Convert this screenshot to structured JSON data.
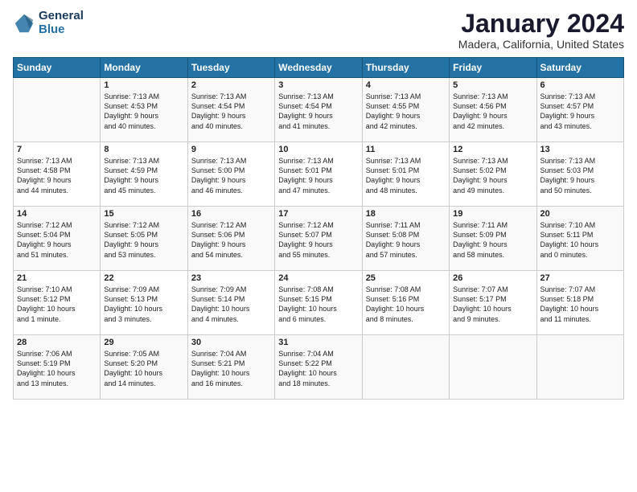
{
  "logo": {
    "line1": "General",
    "line2": "Blue"
  },
  "title": "January 2024",
  "location": "Madera, California, United States",
  "days_header": [
    "Sunday",
    "Monday",
    "Tuesday",
    "Wednesday",
    "Thursday",
    "Friday",
    "Saturday"
  ],
  "weeks": [
    [
      {
        "day": "",
        "data": ""
      },
      {
        "day": "1",
        "data": "Sunrise: 7:13 AM\nSunset: 4:53 PM\nDaylight: 9 hours\nand 40 minutes."
      },
      {
        "day": "2",
        "data": "Sunrise: 7:13 AM\nSunset: 4:54 PM\nDaylight: 9 hours\nand 40 minutes."
      },
      {
        "day": "3",
        "data": "Sunrise: 7:13 AM\nSunset: 4:54 PM\nDaylight: 9 hours\nand 41 minutes."
      },
      {
        "day": "4",
        "data": "Sunrise: 7:13 AM\nSunset: 4:55 PM\nDaylight: 9 hours\nand 42 minutes."
      },
      {
        "day": "5",
        "data": "Sunrise: 7:13 AM\nSunset: 4:56 PM\nDaylight: 9 hours\nand 42 minutes."
      },
      {
        "day": "6",
        "data": "Sunrise: 7:13 AM\nSunset: 4:57 PM\nDaylight: 9 hours\nand 43 minutes."
      }
    ],
    [
      {
        "day": "7",
        "data": "Sunrise: 7:13 AM\nSunset: 4:58 PM\nDaylight: 9 hours\nand 44 minutes."
      },
      {
        "day": "8",
        "data": "Sunrise: 7:13 AM\nSunset: 4:59 PM\nDaylight: 9 hours\nand 45 minutes."
      },
      {
        "day": "9",
        "data": "Sunrise: 7:13 AM\nSunset: 5:00 PM\nDaylight: 9 hours\nand 46 minutes."
      },
      {
        "day": "10",
        "data": "Sunrise: 7:13 AM\nSunset: 5:01 PM\nDaylight: 9 hours\nand 47 minutes."
      },
      {
        "day": "11",
        "data": "Sunrise: 7:13 AM\nSunset: 5:01 PM\nDaylight: 9 hours\nand 48 minutes."
      },
      {
        "day": "12",
        "data": "Sunrise: 7:13 AM\nSunset: 5:02 PM\nDaylight: 9 hours\nand 49 minutes."
      },
      {
        "day": "13",
        "data": "Sunrise: 7:13 AM\nSunset: 5:03 PM\nDaylight: 9 hours\nand 50 minutes."
      }
    ],
    [
      {
        "day": "14",
        "data": "Sunrise: 7:12 AM\nSunset: 5:04 PM\nDaylight: 9 hours\nand 51 minutes."
      },
      {
        "day": "15",
        "data": "Sunrise: 7:12 AM\nSunset: 5:05 PM\nDaylight: 9 hours\nand 53 minutes."
      },
      {
        "day": "16",
        "data": "Sunrise: 7:12 AM\nSunset: 5:06 PM\nDaylight: 9 hours\nand 54 minutes."
      },
      {
        "day": "17",
        "data": "Sunrise: 7:12 AM\nSunset: 5:07 PM\nDaylight: 9 hours\nand 55 minutes."
      },
      {
        "day": "18",
        "data": "Sunrise: 7:11 AM\nSunset: 5:08 PM\nDaylight: 9 hours\nand 57 minutes."
      },
      {
        "day": "19",
        "data": "Sunrise: 7:11 AM\nSunset: 5:09 PM\nDaylight: 9 hours\nand 58 minutes."
      },
      {
        "day": "20",
        "data": "Sunrise: 7:10 AM\nSunset: 5:11 PM\nDaylight: 10 hours\nand 0 minutes."
      }
    ],
    [
      {
        "day": "21",
        "data": "Sunrise: 7:10 AM\nSunset: 5:12 PM\nDaylight: 10 hours\nand 1 minute."
      },
      {
        "day": "22",
        "data": "Sunrise: 7:09 AM\nSunset: 5:13 PM\nDaylight: 10 hours\nand 3 minutes."
      },
      {
        "day": "23",
        "data": "Sunrise: 7:09 AM\nSunset: 5:14 PM\nDaylight: 10 hours\nand 4 minutes."
      },
      {
        "day": "24",
        "data": "Sunrise: 7:08 AM\nSunset: 5:15 PM\nDaylight: 10 hours\nand 6 minutes."
      },
      {
        "day": "25",
        "data": "Sunrise: 7:08 AM\nSunset: 5:16 PM\nDaylight: 10 hours\nand 8 minutes."
      },
      {
        "day": "26",
        "data": "Sunrise: 7:07 AM\nSunset: 5:17 PM\nDaylight: 10 hours\nand 9 minutes."
      },
      {
        "day": "27",
        "data": "Sunrise: 7:07 AM\nSunset: 5:18 PM\nDaylight: 10 hours\nand 11 minutes."
      }
    ],
    [
      {
        "day": "28",
        "data": "Sunrise: 7:06 AM\nSunset: 5:19 PM\nDaylight: 10 hours\nand 13 minutes."
      },
      {
        "day": "29",
        "data": "Sunrise: 7:05 AM\nSunset: 5:20 PM\nDaylight: 10 hours\nand 14 minutes."
      },
      {
        "day": "30",
        "data": "Sunrise: 7:04 AM\nSunset: 5:21 PM\nDaylight: 10 hours\nand 16 minutes."
      },
      {
        "day": "31",
        "data": "Sunrise: 7:04 AM\nSunset: 5:22 PM\nDaylight: 10 hours\nand 18 minutes."
      },
      {
        "day": "",
        "data": ""
      },
      {
        "day": "",
        "data": ""
      },
      {
        "day": "",
        "data": ""
      }
    ]
  ]
}
